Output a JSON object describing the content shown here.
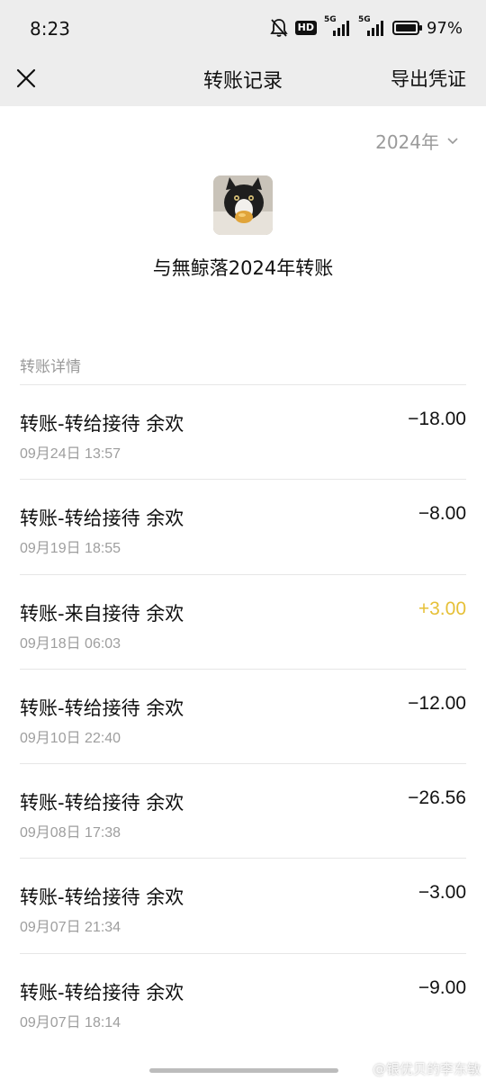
{
  "status_bar": {
    "time": "8:23",
    "hd": "HD",
    "net1": "5G",
    "net2": "5G",
    "battery": "97%"
  },
  "nav": {
    "title": "转账记录",
    "action": "导出凭证",
    "close_icon": "close-icon"
  },
  "year_filter": {
    "value": "2024年",
    "icon": "chevron-down-icon"
  },
  "contact": {
    "summary": "与無鲸落2024年转账"
  },
  "section_label": "转账详情",
  "transactions": [
    {
      "title": "转账-转给接待 余欢",
      "time": "09月24日 13:57",
      "amount": "−18.00"
    },
    {
      "title": "转账-转给接待 余欢",
      "time": "09月19日 18:55",
      "amount": "−8.00"
    },
    {
      "title": "转账-来自接待 余欢",
      "time": "09月18日 06:03",
      "amount": "+3.00"
    },
    {
      "title": "转账-转给接待 余欢",
      "time": "09月10日 22:40",
      "amount": "−12.00"
    },
    {
      "title": "转账-转给接待 余欢",
      "time": "09月08日 17:38",
      "amount": "−26.56"
    },
    {
      "title": "转账-转给接待 余欢",
      "time": "09月07日 21:34",
      "amount": "−3.00"
    },
    {
      "title": "转账-转给接待 余欢",
      "time": "09月07日 18:14",
      "amount": "−9.00"
    }
  ],
  "colors": {
    "header_bg": "#ededed",
    "income": "#e6c037",
    "muted": "#9a9a9a"
  },
  "watermark": "@银优贝的李东敏"
}
